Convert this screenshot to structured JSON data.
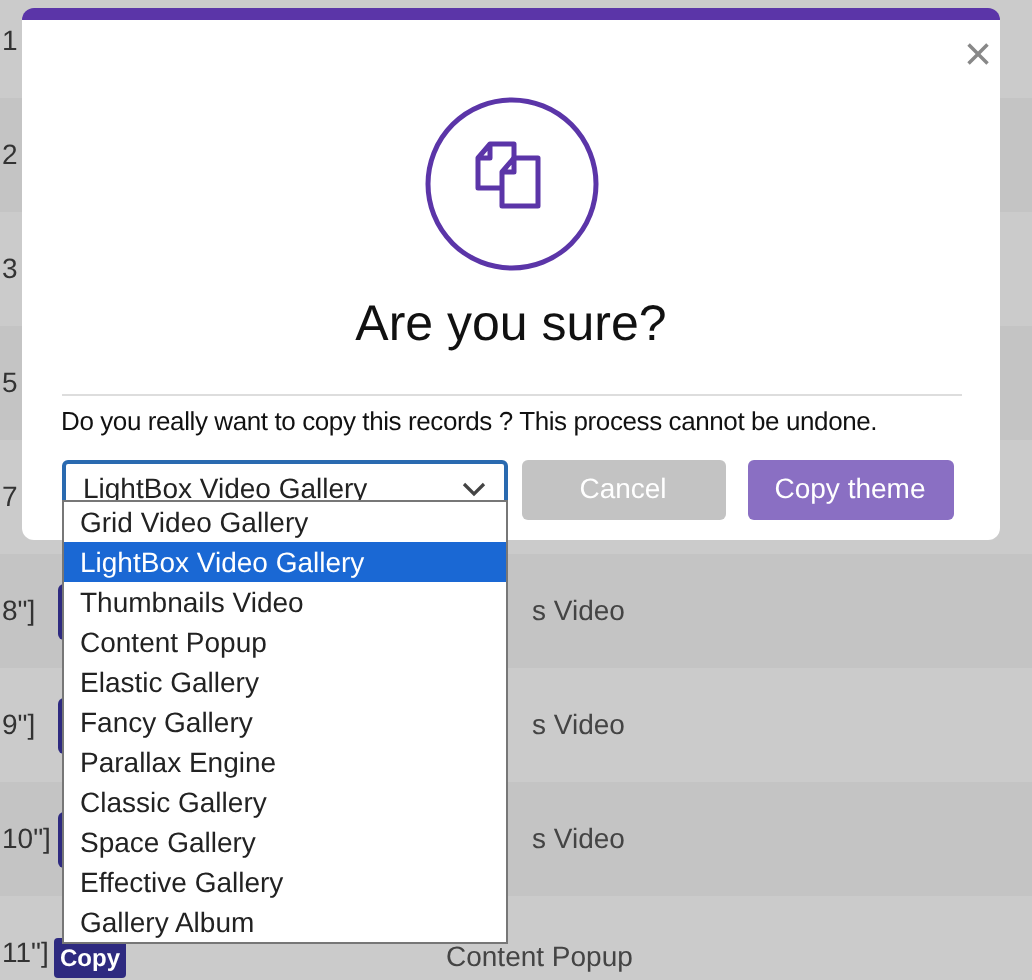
{
  "table": {
    "rows": [
      {
        "index": "1"
      },
      {
        "index": "2"
      },
      {
        "index": "3"
      },
      {
        "index": "5"
      },
      {
        "index": "7"
      },
      {
        "index": "8\"]",
        "button": {
          "kind": "partial"
        },
        "theme": "s Video"
      },
      {
        "index": "9\"]",
        "button": {
          "kind": "partial"
        },
        "theme": "s Video"
      },
      {
        "index": "10\"]",
        "button": {
          "kind": "partial"
        },
        "theme": "s Video"
      },
      {
        "index": "11\"]",
        "button": {
          "kind": "full",
          "label": "Copy"
        },
        "theme": "Content Popup"
      }
    ]
  },
  "dialog": {
    "close": "×",
    "title": "Are you sure?",
    "message": "Do you really want to copy this records ? This process cannot be undone.",
    "select": {
      "value": "LightBox Video Gallery",
      "expanded": true,
      "options": [
        {
          "label": "Grid Video Gallery",
          "selected": false
        },
        {
          "label": "LightBox Video Gallery",
          "selected": true
        },
        {
          "label": "Thumbnails Video",
          "selected": false
        },
        {
          "label": "Content Popup",
          "selected": false
        },
        {
          "label": "Elastic Gallery",
          "selected": false
        },
        {
          "label": "Fancy Gallery",
          "selected": false
        },
        {
          "label": "Parallax Engine",
          "selected": false
        },
        {
          "label": "Classic Gallery",
          "selected": false
        },
        {
          "label": "Space Gallery",
          "selected": false
        },
        {
          "label": "Effective Gallery",
          "selected": false
        },
        {
          "label": "Gallery Album",
          "selected": false
        }
      ]
    },
    "buttons": [
      {
        "label": "Cancel",
        "kind": "cancel"
      },
      {
        "label": "Copy theme",
        "kind": "primary"
      }
    ]
  }
}
